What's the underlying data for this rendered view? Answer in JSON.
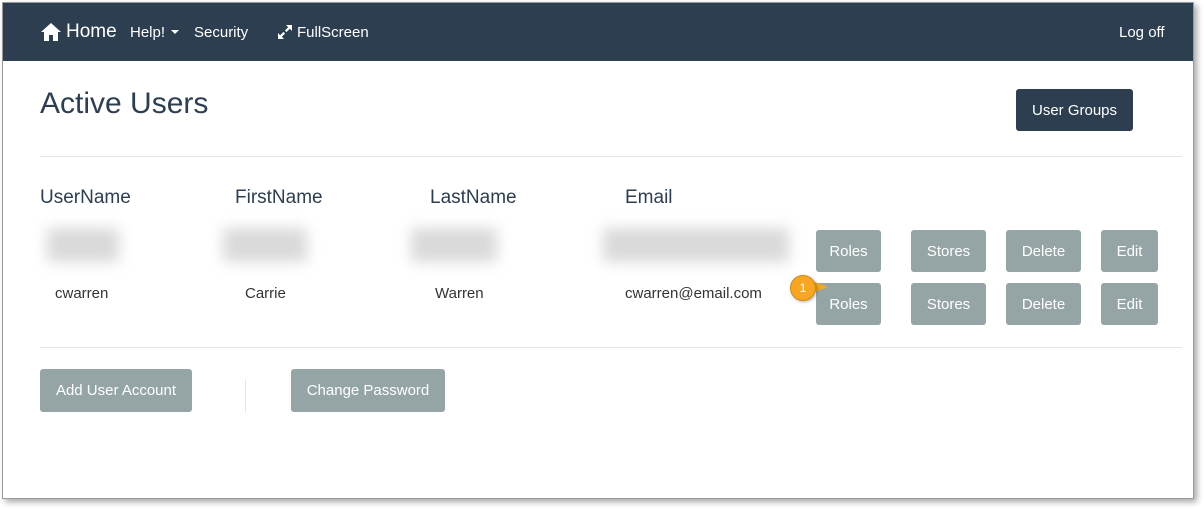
{
  "nav": {
    "home": "Home",
    "help": "Help!",
    "security": "Security",
    "fullscreen": "FullScreen",
    "logoff": "Log off"
  },
  "page": {
    "title": "Active Users",
    "user_groups_button": "User Groups"
  },
  "table": {
    "headers": [
      "UserName",
      "FirstName",
      "LastName",
      "Email"
    ],
    "rows": [
      {
        "username": "",
        "firstname": "",
        "lastname": "",
        "email": "",
        "redacted": true
      },
      {
        "username": "cwarren",
        "firstname": "Carrie",
        "lastname": "Warren",
        "email": "cwarren@email.com",
        "redacted": false
      }
    ],
    "actions": [
      "Roles",
      "Stores",
      "Delete",
      "Edit"
    ]
  },
  "callout": {
    "number": "1",
    "color": "#f5a623"
  },
  "footer": {
    "add_user": "Add User Account",
    "change_password": "Change Password"
  },
  "colors": {
    "navbar": "#2c3e50",
    "button_grey": "#95a5a6",
    "button_dark": "#2c3e50"
  }
}
